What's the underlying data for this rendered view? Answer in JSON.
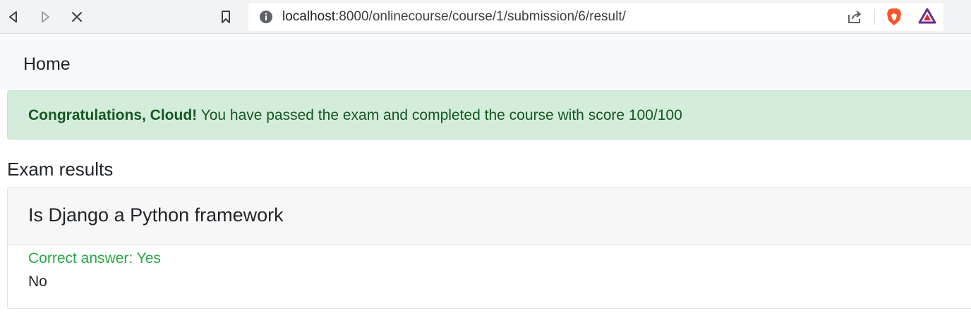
{
  "browser": {
    "url_host": "localhost",
    "url_rest": ":8000/onlinecourse/course/1/submission/6/result/",
    "icons": {
      "back": "back-icon",
      "forward": "forward-icon",
      "stop": "close-icon",
      "bookmark": "bookmark-icon",
      "site_info": "info-icon",
      "share": "share-icon",
      "brave": "brave-lion-icon",
      "rewards": "triangle-icon"
    },
    "colors": {
      "brave_orange": "#fb542b",
      "rewards_purple": "#662d91",
      "rewards_red": "#e6282e"
    }
  },
  "navbar": {
    "home_label": "Home"
  },
  "alert": {
    "bold_text": "Congratulations, Cloud!",
    "message": " You have passed the exam and completed the course with score 100/100",
    "color_bg": "#d4edda",
    "color_text": "#155724"
  },
  "results": {
    "heading": "Exam results",
    "questions": [
      {
        "text": "Is Django a Python framework",
        "correct_answer": "Correct answer: Yes",
        "other_choice": "No"
      }
    ],
    "correct_color": "#28a745"
  }
}
